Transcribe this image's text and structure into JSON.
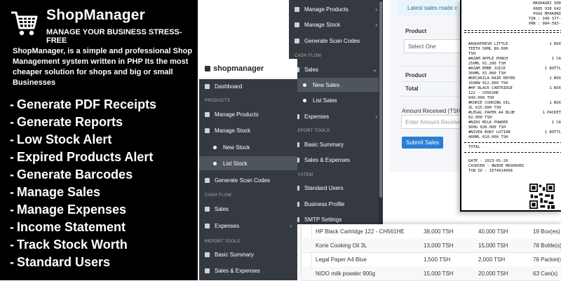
{
  "brand": {
    "name": "ShopManager",
    "tagline": "MANAGE YOUR BUSINESS STRESS-FREE"
  },
  "description": "ShopManager, is a simple and professional Shop Management system written in PHP Its the most cheaper solution for shops and big or small Businesses",
  "features": [
    "Generate PDF Receipts",
    "Generate Reports",
    "Low Stock Alert",
    "Expired Products Alert",
    "Generate Barcodes",
    "Manage Sales",
    "Manage Expenses",
    "Income Statement",
    "Track Stock Worth",
    "Standard Users"
  ],
  "sidebar_a": {
    "header": "shopmanager",
    "items": [
      {
        "label": "Dashboard"
      },
      {
        "label": "PRODUCTS"
      },
      {
        "label": "Manage Products"
      },
      {
        "label": "Manage Stock"
      },
      {
        "label": "New Stock"
      },
      {
        "label": "List Stock"
      },
      {
        "label": "Generate Scan Codes"
      },
      {
        "label": "CASH FLOW"
      },
      {
        "label": "Sales"
      },
      {
        "label": "Expenses"
      },
      {
        "label": "REPORT TOOLS"
      },
      {
        "label": "Basic Summary"
      },
      {
        "label": "Sales & Expenses"
      }
    ]
  },
  "sidebar_b": {
    "items": [
      {
        "label": "Manage Products"
      },
      {
        "label": "Manage Stock"
      },
      {
        "label": "Generate Scan Codes"
      },
      {
        "label": "CASH FLOW"
      },
      {
        "label": "Sales"
      },
      {
        "label": "New Sales"
      },
      {
        "label": "List Sales"
      },
      {
        "label": "Expenses"
      },
      {
        "label": "REPORT TOOLS"
      },
      {
        "label": "Basic Summary"
      },
      {
        "label": "Sales & Expenses"
      },
      {
        "label": "SYSTEM"
      },
      {
        "label": "Standard Users"
      },
      {
        "label": "Business Profile"
      },
      {
        "label": "SMTP Settings"
      }
    ]
  },
  "sales_form": {
    "alert": "Latest sales made c",
    "product_label": "Product",
    "select_value": "Select One",
    "product_label2": "Product",
    "total_label": "Total",
    "amount_label": "Amount Received (TSH",
    "amount_placeholder": "Enter Amount Receive",
    "submit": "Submit Sales"
  },
  "receipt": {
    "header": [
      "MASHAURI SHO",
      "0685 930 642",
      "PUGU MPAKANI",
      "TIN : 346-377-",
      "VRN : 984-583-"
    ],
    "items": [
      {
        "name": "#AQUAFRESH LITTLE",
        "qty": "1 BOX",
        "detail": "TEETH 50ML 80.000"
      },
      {
        "name": "TSH",
        "qty": "",
        "detail": ""
      },
      {
        "name": "#AZAM APPLE PUNCH",
        "qty": "1 CA",
        "detail": "250ML 01.200 TSH"
      },
      {
        "name": "#AZAM EMBE JUICE",
        "qty": "1 BOTTL",
        "detail": "300ML 01.000 TSH"
      },
      {
        "name": "#DECAKILA HAIR DRYER",
        "qty": "1 BOX",
        "detail": "1600W 012.000 TSH"
      },
      {
        "name": "#HP BLACK CARTRIDGE",
        "qty": "1 BOX",
        "detail": "122 - CH561HE"
      },
      {
        "name": "040.000 TSH",
        "qty": "",
        "detail": ""
      },
      {
        "name": "#KORIE COOKING OIL",
        "qty": "1 BOX",
        "detail": "3L 015.000 TSH"
      },
      {
        "name": "#LEGAL PAPER A4 BLUE",
        "qty": "1 PACKET",
        "detail": "02.000 TSH"
      },
      {
        "name": "#NIDO MILK POWDER",
        "qty": "1 CA",
        "detail": "900G 020.000 TSH"
      },
      {
        "name": "#NIVEA BODY LOTION",
        "qty": "1 BOTTL",
        "detail": "400ML 010.000 TSH"
      }
    ],
    "total_label": "TOTAL",
    "date": "DATE : 2023-01-20",
    "cashier": "CASHIER : BWIRE MASHAURI",
    "txn": "TXN ID : 1674914098"
  },
  "stock_table": {
    "rows": [
      {
        "product": "HP Black Cartridge 122 - CH561HE",
        "buy": "38,000 TSH",
        "sell": "40,000 TSH",
        "qty": "19 Box(es)"
      },
      {
        "product": "Korie Cooking Oil 3L",
        "buy": "13,000 TSH",
        "sell": "15,000 TSH",
        "qty": "78 Bottle(s)"
      },
      {
        "product": "Legal Paper A4 Blue",
        "buy": "1,500 TSH",
        "sell": "2,000 TSH",
        "qty": "76 Packet(s)"
      },
      {
        "product": "NIDO milk powder 900g",
        "buy": "15,000 TSH",
        "sell": "20,000 TSH",
        "qty": "63 Can(s)"
      }
    ]
  },
  "colors": {
    "dark_sidebar": "#343a40",
    "active_item": "#4e555b",
    "submit_button": "#2a7fd4",
    "alert_bg": "#e8f4fb"
  }
}
